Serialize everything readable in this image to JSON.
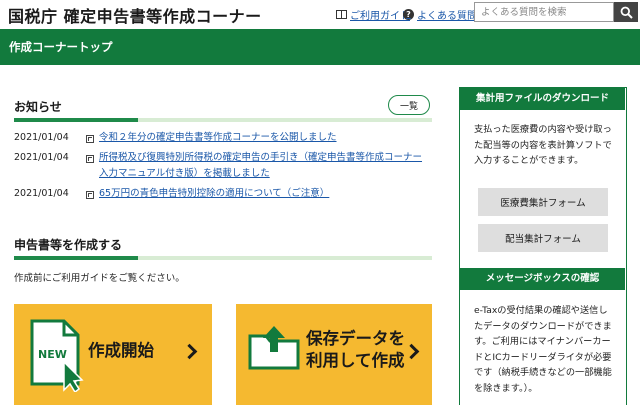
{
  "header": {
    "site_title": "国税庁 確定申告書等作成コーナー",
    "guide_link": "ご利用ガイド",
    "faq_link": "よくある質問",
    "search_placeholder": "よくある質問を検索",
    "icons": [
      "book-icon",
      "question-icon",
      "search-icon"
    ]
  },
  "greenbar": {
    "label": "作成コーナートップ"
  },
  "news": {
    "title": "お知らせ",
    "list_button": "一覧",
    "items": [
      {
        "date": "2021/01/04",
        "text": "令和２年分の確定申告書等作成コーナーを公開しました"
      },
      {
        "date": "2021/01/04",
        "text": "所得税及び復興特別所得税の確定申告の手引き（確定申告書等作成コーナー入力マニュアル付き版）を掲載しました"
      },
      {
        "date": "2021/01/04",
        "text": "65万円の青色申告特別控除の適用について（ご注意）"
      }
    ]
  },
  "create": {
    "title": "申告書等を作成する",
    "guide_text": "作成前にご利用ガイドをご覧ください。",
    "start_tile": {
      "badge": "NEW",
      "label": "作成開始"
    },
    "saved_tile": {
      "label_line1": "保存データを",
      "label_line2": "利用して作成"
    }
  },
  "sidebar": {
    "download": {
      "title": "集計用ファイルのダウンロード",
      "text": "支払った医療費の内容や受け取った配当等の内容を表計算ソフトで入力することができます。",
      "buttons": [
        "医療費集計フォーム",
        "配当集計フォーム"
      ]
    },
    "messagebox": {
      "title": "メッセージボックスの確認",
      "text": "e-Taxの受付結果の確認や送信したデータのダウンロードができます。ご利用にはマイナンバーカードとICカードリーダライタが必要です（納税手続きなどの一部機能を除きます。）。"
    }
  },
  "colors": {
    "brand_green": "#127a3d",
    "tile_yellow": "#f5b930",
    "link_blue": "#1a57a8"
  }
}
